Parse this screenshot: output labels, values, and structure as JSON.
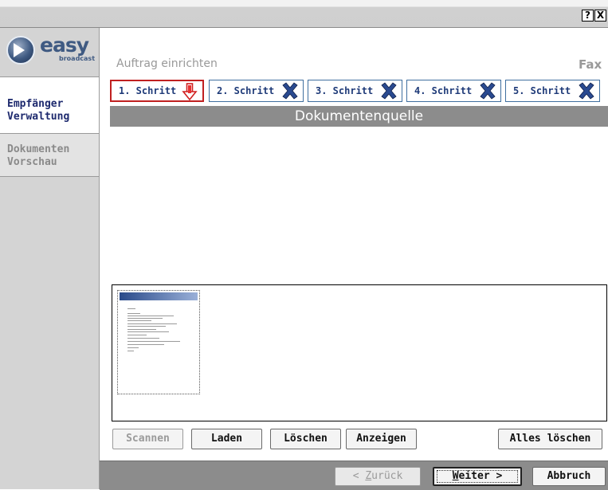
{
  "titlebar": {
    "help_label": "?",
    "close_label": "X"
  },
  "logo": {
    "brand": "easy",
    "sub": "broadcast"
  },
  "sidebar": {
    "items": [
      {
        "line1": "Empfänger",
        "line2": "Verwaltung",
        "active": true
      },
      {
        "line1": "Dokumenten",
        "line2": "Vorschau",
        "active": false
      }
    ]
  },
  "header": {
    "subtitle": "Auftrag einrichten",
    "fax_label": "Fax"
  },
  "steps": [
    {
      "label": "1. Schritt",
      "state": "current",
      "icon": "arrow-down-icon"
    },
    {
      "label": "2. Schritt",
      "state": "pending",
      "icon": "x-mark-icon"
    },
    {
      "label": "3. Schritt",
      "state": "pending",
      "icon": "x-mark-icon"
    },
    {
      "label": "4. Schritt",
      "state": "pending",
      "icon": "x-mark-icon"
    },
    {
      "label": "5. Schritt",
      "state": "pending",
      "icon": "x-mark-icon"
    }
  ],
  "section": {
    "title": "Dokumentenquelle"
  },
  "buttons": {
    "scannen": "Scannen",
    "laden": "Laden",
    "loeschen": "Löschen",
    "anzeigen": "Anzeigen",
    "alles_loeschen": "Alles löschen"
  },
  "footer": {
    "back_prefix": "< ",
    "back_accel": "Z",
    "back_rest": "urück",
    "next_accel": "W",
    "next_rest": "eiter >",
    "cancel": "Abbruch"
  },
  "colors": {
    "accent_blue": "#1e3a78",
    "step_border": "#3f6f9f",
    "active_step_border": "#c02020",
    "section_bar": "#8c8c8c"
  }
}
